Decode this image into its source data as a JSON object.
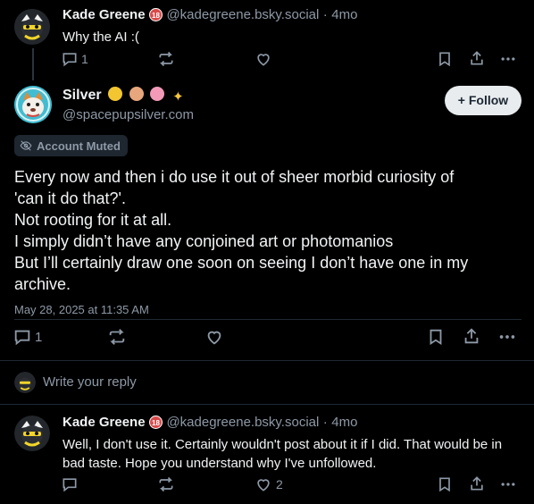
{
  "parent_post": {
    "author_name": "Kade Greene",
    "handle": "@kadegreene.bsky.social",
    "separator": "·",
    "time": "4mo",
    "text": "Why the AI :(",
    "reply_count": "1"
  },
  "main_post": {
    "author_name": "Silver",
    "name_emojis": [
      "nerd-face",
      "dog-face",
      "brain",
      "sparkles"
    ],
    "handle": "@spacepupsilver.com",
    "follow_label": "+ Follow",
    "muted_label": "Account Muted",
    "text_lines": [
      "Every now and then i do use it out of sheer morbid curiosity of",
      "'can it do that?'.",
      "Not rooting for it at all.",
      "I simply didn’t have any conjoined art or photomanios",
      "But I’ll certainly draw one soon on seeing I don’t have one in my",
      "archive."
    ],
    "timestamp": "May 28, 2025 at 11:35 AM",
    "reply_count": "1"
  },
  "reply_box": {
    "placeholder": "Write your reply"
  },
  "reply_post": {
    "author_name": "Kade Greene",
    "handle": "@kadegreene.bsky.social",
    "separator": "·",
    "time": "4mo",
    "text": "Well, I don't use it. Certainly wouldn't post about it if I did. That would be in bad taste. Hope you understand why I've unfollowed.",
    "like_count": "2"
  },
  "colors": {
    "background": "#000000",
    "text": "#f1f3f5",
    "muted": "#8d99a6",
    "follow_button_bg": "#e8ecef",
    "muted_badge_bg": "#1e2630"
  },
  "icons": [
    "reply-icon",
    "repost-icon",
    "like-icon",
    "bookmark-icon",
    "share-icon",
    "more-icon"
  ]
}
